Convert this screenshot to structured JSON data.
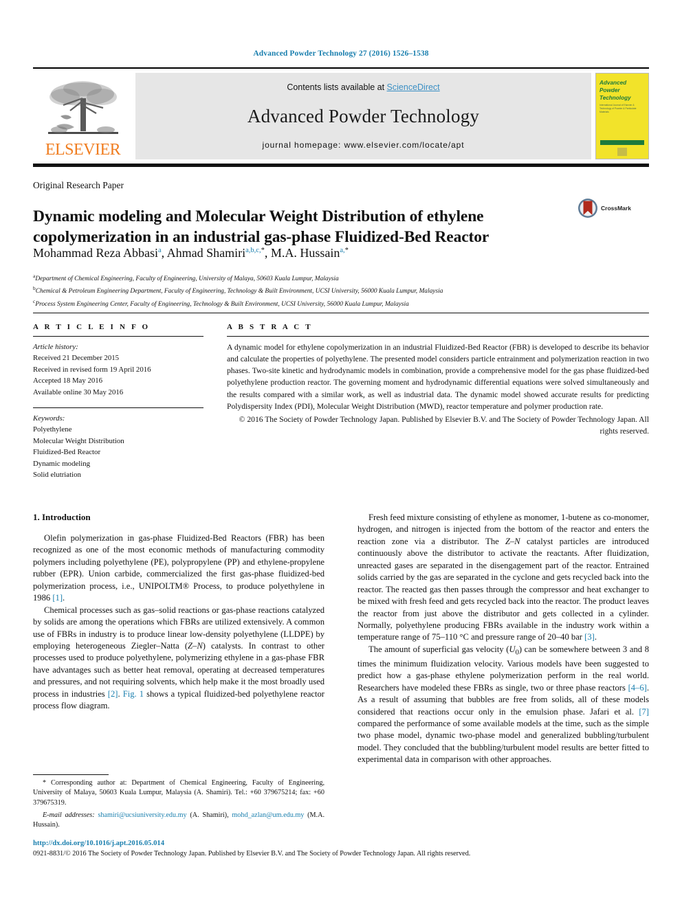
{
  "running_head": "Advanced Powder Technology 27 (2016) 1526–1538",
  "masthead": {
    "contents_prefix": "Contents lists available at ",
    "sciencedirect": "ScienceDirect",
    "journal_title": "Advanced Powder Technology",
    "homepage": "journal homepage: www.elsevier.com/locate/apt",
    "publisher_wordmark": "ELSEVIER",
    "cover": {
      "line1": "Advanced",
      "line2": "Powder",
      "line3": "Technology",
      "subtitle": "International Journal of Elsevier & Technology of Powder & Particulate Materials"
    },
    "accent_blue": "#3a8fc4",
    "elsevier_orange": "#f07d20",
    "cover_yellow": "#f2e32a",
    "cover_green": "#1d7a3c"
  },
  "article": {
    "type": "Original Research Paper",
    "title": "Dynamic modeling and Molecular Weight Distribution of ethylene copolymerization in an industrial gas-phase Fluidized-Bed Reactor",
    "crossmark_label": "CrossMark",
    "authors_html": "Mohammad Reza Abbasi<sup>a</sup>, Ahmad Shamiri<sup>a,b,c,</sup><sup class=\"blk\">*</sup>, M.A. Hussain<sup>a,</sup><sup class=\"blk\">*</sup>",
    "affiliations": [
      {
        "marker": "a",
        "text": "Department of Chemical Engineering, Faculty of Engineering, University of Malaya, 50603 Kuala Lumpur, Malaysia"
      },
      {
        "marker": "b",
        "text": "Chemical & Petroleum Engineering Department, Faculty of Engineering, Technology & Built Environment, UCSI University, 56000 Kuala Lumpur, Malaysia"
      },
      {
        "marker": "c",
        "text": "Process System Engineering Center, Faculty of Engineering, Technology & Built Environment, UCSI University, 56000 Kuala Lumpur, Malaysia"
      }
    ]
  },
  "article_info": {
    "heading": "A R T I C L E    I N F O",
    "history_label": "Article history:",
    "history": [
      "Received 21 December 2015",
      "Received in revised form 19 April 2016",
      "Accepted 18 May 2016",
      "Available online 30 May 2016"
    ],
    "keywords_label": "Keywords:",
    "keywords": [
      "Polyethylene",
      "Molecular Weight Distribution",
      "Fluidized-Bed Reactor",
      "Dynamic modeling",
      "Solid elutriation"
    ]
  },
  "abstract": {
    "heading": "A B S T R A C T",
    "body": "A dynamic model for ethylene copolymerization in an industrial Fluidized-Bed Reactor (FBR) is developed to describe its behavior and calculate the properties of polyethylene. The presented model considers particle entrainment and polymerization reaction in two phases. Two-site kinetic and hydrodynamic models in combination, provide a comprehensive model for the gas phase fluidized-bed polyethylene production reactor. The governing moment and hydrodynamic differential equations were solved simultaneously and the results compared with a similar work, as well as industrial data. The dynamic model showed accurate results for predicting Polydispersity Index (PDI), Molecular Weight Distribution (MWD), reactor temperature and polymer production rate.",
    "copyright": "© 2016 The Society of Powder Technology Japan. Published by Elsevier B.V. and The Society of Powder Technology Japan. All rights reserved."
  },
  "body": {
    "section_heading": "1. Introduction",
    "left_paragraphs": [
      "Olefin polymerization in gas-phase Fluidized-Bed Reactors (FBR) has been recognized as one of the most economic methods of manufacturing commodity polymers including polyethylene (PE), polypropylene (PP) and ethylene-propylene rubber (EPR). Union carbide, commercialized the first gas-phase fluidized-bed polymerization process, i.e., UNIPOLTM® Process, to produce polyethylene in 1986 [1].",
      "Chemical processes such as gas–solid reactions or gas-phase reactions catalyzed by solids are among the operations which FBRs are utilized extensively. A common use of FBRs in industry is to produce linear low-density polyethylene (LLDPE) by employing heterogeneous Ziegler–Natta (Z–N) catalysts. In contrast to other processes used to produce polyethylene, polymerizing ethylene in a gas-phase FBR have advantages such as better heat removal, operating at decreased temperatures and pressures, and not requiring solvents, which help make it the most broadly used process in industries [2]. Fig. 1 shows a typical fluidized-bed polyethylene reactor process flow diagram."
    ],
    "right_paragraphs": [
      "Fresh feed mixture consisting of ethylene as monomer, 1-butene as co-monomer, hydrogen, and nitrogen is injected from the bottom of the reactor and enters the reaction zone via a distributor. The Z–N catalyst particles are introduced continuously above the distributor to activate the reactants. After fluidization, unreacted gases are separated in the disengagement part of the reactor. Entrained solids carried by the gas are separated in the cyclone and gets recycled back into the reactor. The reacted gas then passes through the compressor and heat exchanger to be mixed with fresh feed and gets recycled back into the reactor. The product leaves the reactor from just above the distributor and gets collected in a cylinder. Normally, polyethylene producing FBRs available in the industry work within a temperature range of 75–110 °C and pressure range of 20–40 bar [3].",
      "The amount of superficial gas velocity (U0) can be somewhere between 3 and 8 times the minimum fluidization velocity. Various models have been suggested to predict how a gas-phase ethylene polymerization perform in the real world. Researchers have modeled these FBRs as single, two or three phase reactors [4–6]. As a result of assuming that bubbles are free from solids, all of these models considered that reactions occur only in the emulsion phase. Jafari et al. [7] compared the performance of some available models at the time, such as the simple two phase model, dynamic two-phase model and generalized bubbling/turbulent model. They concluded that the bubbling/turbulent model results are better fitted to experimental data in comparison with other approaches."
    ]
  },
  "footnotes": {
    "corresponding": "* Corresponding author at: Department of Chemical Engineering, Faculty of Engineering, University of Malaya, 50603 Kuala Lumpur, Malaysia (A. Shamiri). Tel.: +60 379675214; fax: +60 379675319.",
    "email_label": "E-mail addresses:",
    "email1": "shamiri@ucsiuniversity.edu.my",
    "email1_owner": "(A. Shamiri)",
    "email2": "mohd_azlan@um.edu.my",
    "email2_owner": "(M.A. Hussain).",
    "doi": "http://dx.doi.org/10.1016/j.apt.2016.05.014",
    "issn_line": "0921-8831/© 2016 The Society of Powder Technology Japan. Published by Elsevier B.V. and The Society of Powder Technology Japan. All rights reserved.",
    "link_color": "#1a7fae"
  }
}
